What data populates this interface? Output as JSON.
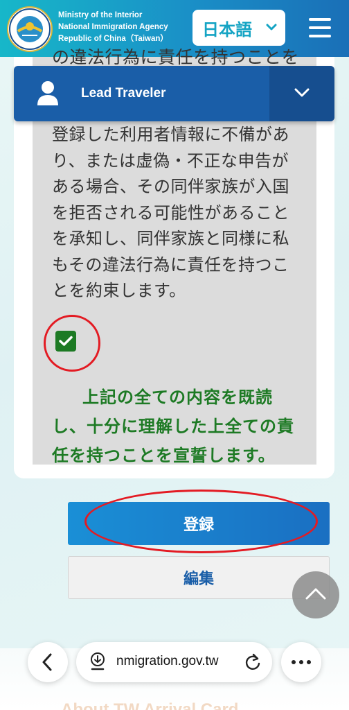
{
  "header": {
    "agency_lines": [
      "Ministry of the Interior",
      "National Immigration Agency",
      "Republic of China（Taiwan）"
    ],
    "language_selected": "日本語",
    "logo_icon": "nia-emblem-icon"
  },
  "traveler": {
    "title": "Lead Traveler"
  },
  "declaration": {
    "cut_line": "の違法行為に責任を持つことを",
    "notice_lines": [
      "登録した利用者情報に不備があ",
      "り、または虚偽・不正な申告が",
      "ある場合、その同伴家族が入国",
      "を拒否される可能性があること",
      "を承知し、同伴家族と同様に私",
      "もその違法行為に責任を持つこ",
      "とを約束します。"
    ],
    "agree_text": "上記の全ての内容を既読し、十分に理解した上全ての責任を持つことを宣誓します。",
    "checked": true
  },
  "actions": {
    "register_label": "登録",
    "edit_label": "編集"
  },
  "footer": {
    "partial_text": "About TW Arrival Card"
  },
  "browser": {
    "url": "nmigration.gov.tw"
  },
  "colors": {
    "header_start": "#17b7c9",
    "header_end": "#1a6fb7",
    "traveler_bar": "#1a5ea8",
    "agree_green": "#1d7a24",
    "annotation_red": "#e31b23"
  }
}
